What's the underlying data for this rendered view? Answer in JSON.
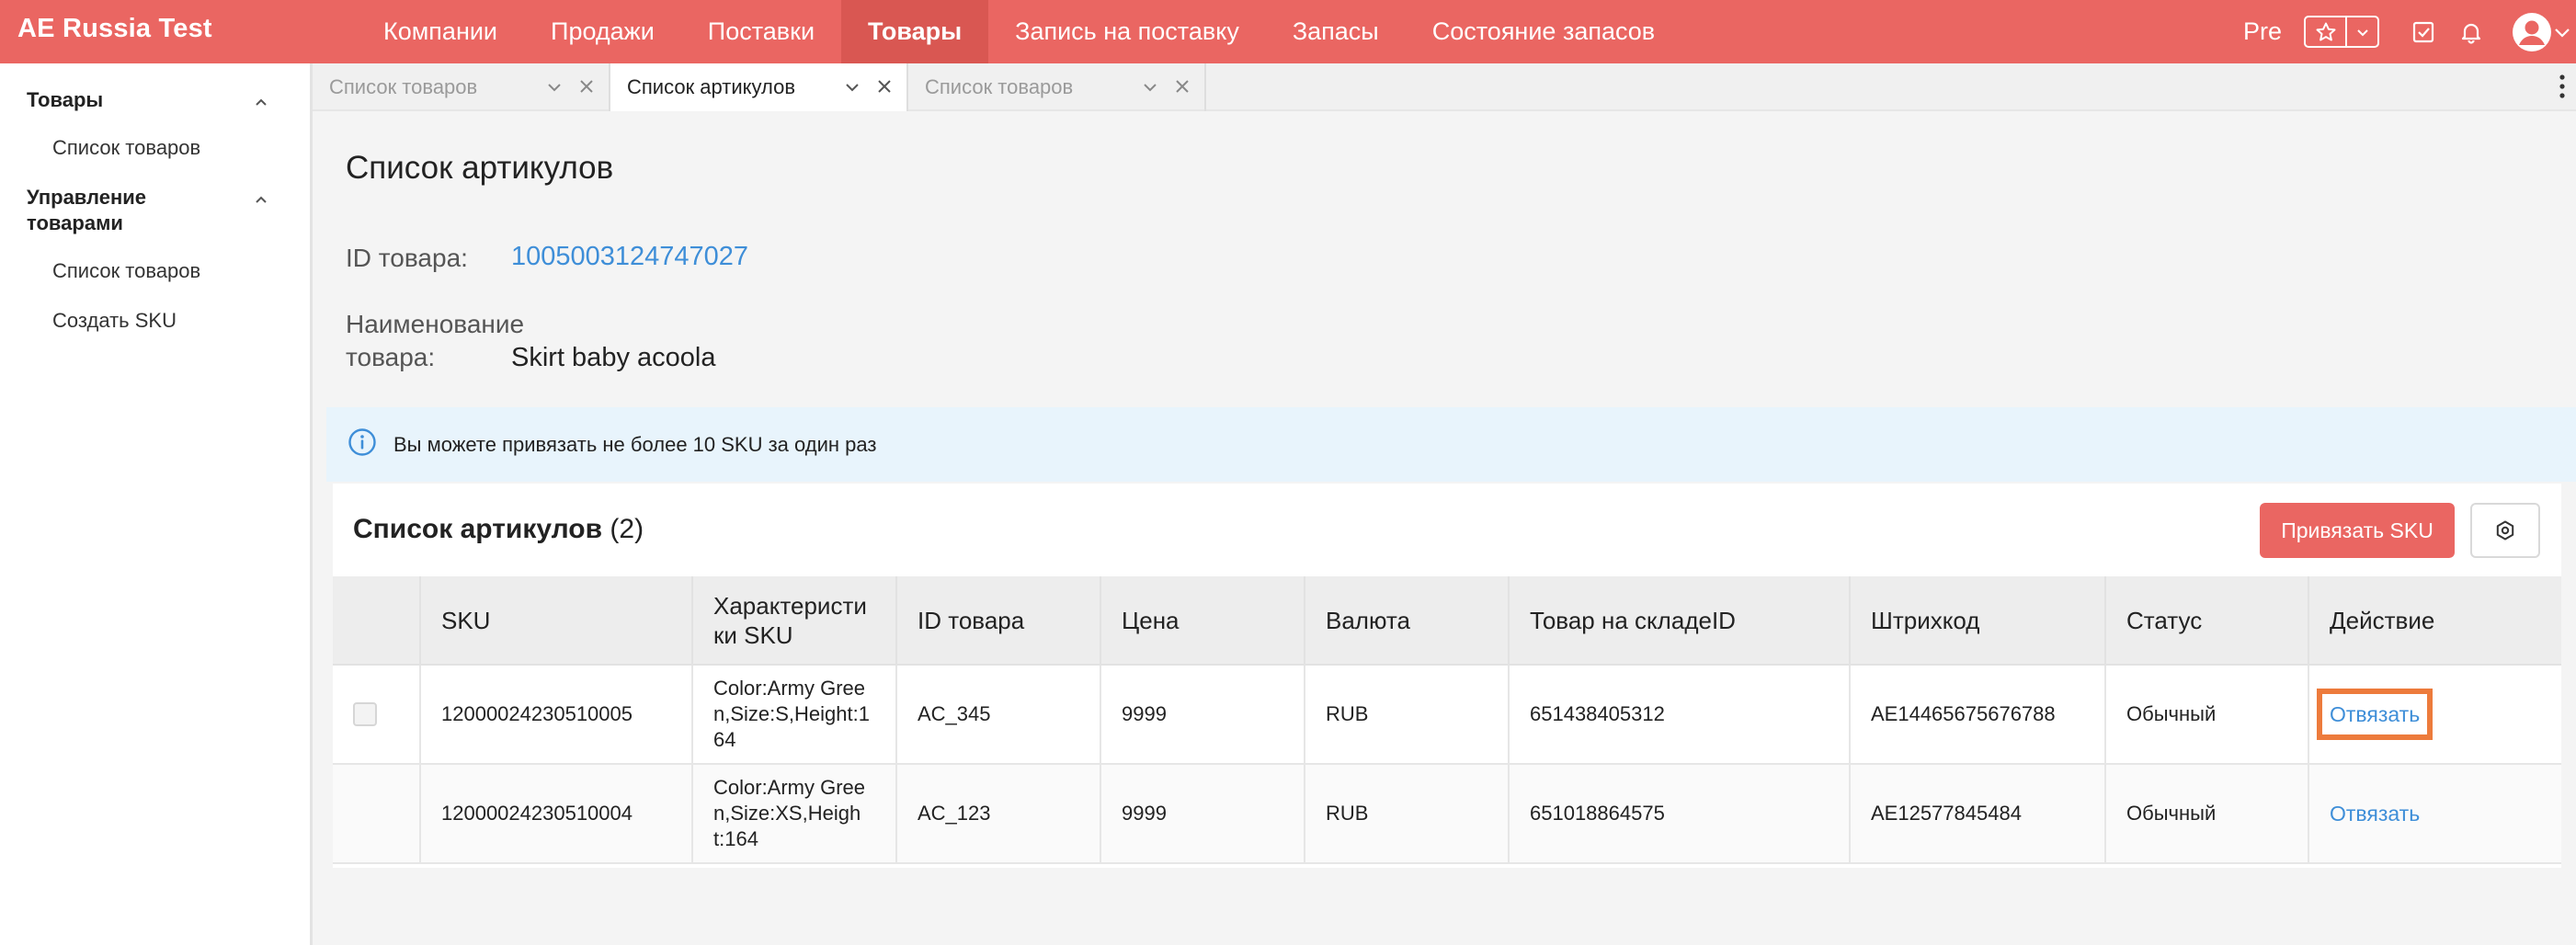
{
  "app": {
    "brand": "AE Russia Test",
    "nav": [
      "Компании",
      "Продажи",
      "Поставки",
      "Товары",
      "Запись на поставку",
      "Запасы",
      "Состояние запасов"
    ],
    "nav_active": "Товары",
    "pre_label": "Pre",
    "accent_color": "#ea6662"
  },
  "sidebar": {
    "groups": [
      {
        "label": "Товары",
        "items": [
          "Список товаров"
        ]
      },
      {
        "label_lines": [
          "Управление",
          "товарами"
        ],
        "items": [
          "Список товаров",
          "Создать SKU"
        ]
      }
    ]
  },
  "tabs": [
    {
      "label": "Список товаров",
      "active": false
    },
    {
      "label": "Список артикулов",
      "active": true
    },
    {
      "label": "Список товаров",
      "active": false
    }
  ],
  "page": {
    "title": "Список артикулов",
    "product_id_label": "ID товара:",
    "product_id_value": "1005003124747027",
    "product_name_label_lines": [
      "Наименование",
      "товара:"
    ],
    "product_name_value": "Skirt baby acoola",
    "info_text": "Вы можете привязать не более 10 SKU за один раз"
  },
  "table": {
    "title": "Список артикулов",
    "count": "(2)",
    "bind_button": "Привязать SKU",
    "columns": [
      "SKU",
      "Характеристи ки SKU",
      "ID товара",
      "Цена",
      "Валюта",
      "Товар на складеID",
      "Штрихкод",
      "Статус",
      "Действие"
    ],
    "rows": [
      {
        "sku": "12000024230510005",
        "characteristics": "Color:Army Gree n,Size:S,Height:1 64",
        "product_id": "AC_345",
        "price": "9999",
        "currency": "RUB",
        "warehouse_id": "651438405312",
        "barcode": "AE14465675676788",
        "status": "Обычный",
        "action": "Отвязать"
      },
      {
        "sku": "12000024230510004",
        "characteristics": "Color:Army Gree n,Size:XS,Heigh t:164",
        "product_id": "AC_123",
        "price": "9999",
        "currency": "RUB",
        "warehouse_id": "651018864575",
        "barcode": "AE12577845484",
        "status": "Обычный",
        "action": "Отвязать"
      }
    ]
  }
}
